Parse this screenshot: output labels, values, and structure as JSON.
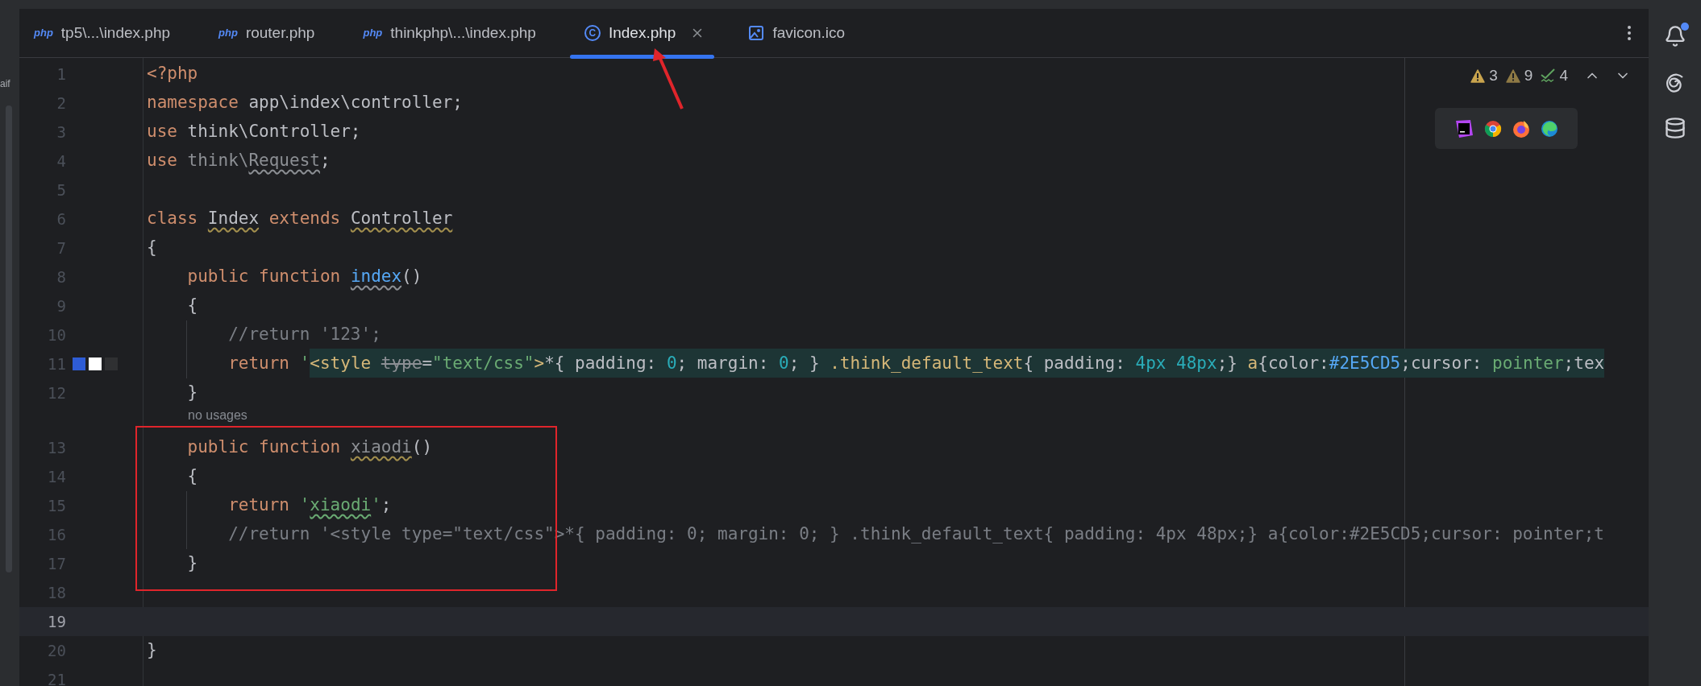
{
  "side_panel": {
    "text": "aif"
  },
  "tabs": [
    {
      "label": "tp5\\...\\index.php",
      "kind": "php",
      "icon_label": "php",
      "selected": false,
      "closable": false
    },
    {
      "label": "router.php",
      "kind": "php",
      "icon_label": "php",
      "selected": false,
      "closable": false
    },
    {
      "label": "thinkphp\\...\\index.php",
      "kind": "php",
      "icon_label": "php",
      "selected": false,
      "closable": false
    },
    {
      "label": "Index.php",
      "kind": "class",
      "icon_label": "C",
      "selected": true,
      "closable": true
    },
    {
      "label": "favicon.ico",
      "kind": "image",
      "selected": false,
      "closable": false
    }
  ],
  "inspections": [
    {
      "kind": "warning",
      "count": "3"
    },
    {
      "kind": "weak",
      "count": "9"
    },
    {
      "kind": "typo",
      "count": "4"
    }
  ],
  "lines": [
    {
      "kind": "code",
      "number": "1",
      "current": false,
      "tokens": [
        {
          "t": "<?php",
          "kind": "keyword"
        }
      ]
    },
    {
      "kind": "code",
      "number": "2",
      "current": false,
      "tokens": [
        {
          "t": "namespace ",
          "kind": "keyword"
        },
        {
          "t": "app\\index\\controller;",
          "kind": "plain"
        }
      ]
    },
    {
      "kind": "code",
      "number": "3",
      "current": false,
      "tokens": [
        {
          "t": "use ",
          "kind": "keyword"
        },
        {
          "t": "think\\Controller;",
          "kind": "plain"
        }
      ]
    },
    {
      "kind": "code",
      "number": "4",
      "current": false,
      "tokens": [
        {
          "t": "use ",
          "kind": "keyword"
        },
        {
          "t": "think\\",
          "kind": "unused"
        },
        {
          "t": "Request",
          "kind": "unused",
          "weak": true
        },
        {
          "t": ";",
          "kind": "plain"
        }
      ]
    },
    {
      "kind": "code",
      "number": "5",
      "current": false
    },
    {
      "kind": "code",
      "number": "6",
      "current": false,
      "tokens": [
        {
          "t": "class ",
          "kind": "keyword"
        },
        {
          "t": "Index",
          "kind": "plain",
          "warning": true
        },
        {
          "t": " extends ",
          "kind": "keyword"
        },
        {
          "t": "Controller",
          "kind": "plain",
          "warning": true
        }
      ]
    },
    {
      "kind": "code",
      "number": "7",
      "current": false,
      "tokens": [
        {
          "t": "{",
          "kind": "plain"
        }
      ]
    },
    {
      "kind": "code",
      "number": "8",
      "current": false,
      "tokens": [
        {
          "t": "    public function ",
          "kind": "keyword"
        },
        {
          "t": "index",
          "kind": "function",
          "weak": true
        },
        {
          "t": "()",
          "kind": "plain"
        }
      ]
    },
    {
      "kind": "code",
      "number": "9",
      "current": false,
      "tokens": [
        {
          "t": "    {",
          "kind": "plain"
        }
      ]
    },
    {
      "kind": "code",
      "number": "10",
      "current": false,
      "tokens": [
        {
          "t": "        //return '123';",
          "kind": "comment"
        }
      ]
    },
    {
      "kind": "code",
      "number": "11",
      "current": false,
      "swatches": [
        {
          "color": "#2e5cd5"
        },
        {
          "color": "#ffffff"
        },
        {
          "color": "#2f3032"
        }
      ],
      "tokens": [
        {
          "t": "        return ",
          "kind": "keyword"
        },
        {
          "t": "'",
          "kind": "string"
        }
      ],
      "injection": [
        {
          "t": "<style ",
          "kind": "tag"
        },
        {
          "t": "type",
          "kind": "unused",
          "deprecated": true
        },
        {
          "t": "=",
          "kind": "plain"
        },
        {
          "t": "\"text/css\"",
          "kind": "string"
        },
        {
          "t": ">",
          "kind": "tag"
        },
        {
          "t": "*{ padding: ",
          "kind": "plain"
        },
        {
          "t": "0",
          "kind": "number"
        },
        {
          "t": "; margin: ",
          "kind": "plain"
        },
        {
          "t": "0",
          "kind": "number"
        },
        {
          "t": "; } ",
          "kind": "plain"
        },
        {
          "t": ".think_default_text",
          "kind": "tag"
        },
        {
          "t": "{ padding: ",
          "kind": "plain"
        },
        {
          "t": "4px 48px",
          "kind": "number"
        },
        {
          "t": ";} ",
          "kind": "plain"
        },
        {
          "t": "a",
          "kind": "tag"
        },
        {
          "t": "{color:",
          "kind": "plain"
        },
        {
          "t": "#2E5CD5",
          "kind": "function"
        },
        {
          "t": ";cursor: ",
          "kind": "plain"
        },
        {
          "t": "pointer",
          "kind": "string"
        },
        {
          "t": ";tex",
          "kind": "plain"
        }
      ]
    },
    {
      "kind": "code",
      "number": "12",
      "current": false,
      "tokens": [
        {
          "t": "    }",
          "kind": "plain"
        }
      ]
    },
    {
      "kind": "hint",
      "text": "no usages"
    },
    {
      "kind": "code",
      "number": "13",
      "current": false,
      "tokens": [
        {
          "t": "    public function ",
          "kind": "keyword"
        },
        {
          "t": "xiaodi",
          "kind": "unused",
          "warning": true
        },
        {
          "t": "()",
          "kind": "plain"
        }
      ]
    },
    {
      "kind": "code",
      "number": "14",
      "current": false,
      "tokens": [
        {
          "t": "    {",
          "kind": "plain"
        }
      ]
    },
    {
      "kind": "code",
      "number": "15",
      "current": false,
      "tokens": [
        {
          "t": "        return ",
          "kind": "keyword"
        },
        {
          "t": "'",
          "kind": "string"
        },
        {
          "t": "xiaodi",
          "kind": "string",
          "typo": true
        },
        {
          "t": "'",
          "kind": "string"
        },
        {
          "t": ";",
          "kind": "plain"
        }
      ]
    },
    {
      "kind": "code",
      "number": "16",
      "current": false,
      "tokens": [
        {
          "t": "        //return '<style type=\"text/css\">*{ padding: 0; margin: 0; } .think_default_text{ padding: 4px 48px;} a{color:#2E5CD5;cursor: pointer;t",
          "kind": "comment"
        }
      ]
    },
    {
      "kind": "code",
      "number": "17",
      "current": false,
      "tokens": [
        {
          "t": "    }",
          "kind": "plain"
        }
      ]
    },
    {
      "kind": "code",
      "number": "18",
      "current": false
    },
    {
      "kind": "code",
      "number": "19",
      "current": true
    },
    {
      "kind": "code",
      "number": "20",
      "current": false,
      "tokens": [
        {
          "t": "}",
          "kind": "plain"
        }
      ]
    },
    {
      "kind": "code",
      "number": "21",
      "current": false
    }
  ]
}
